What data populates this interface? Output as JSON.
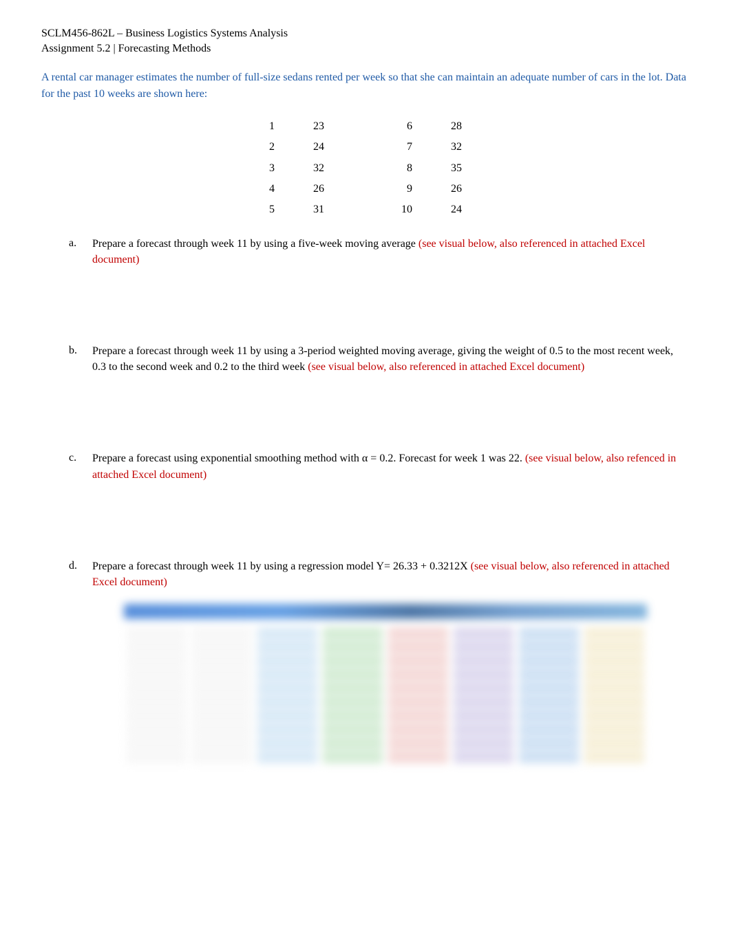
{
  "header": {
    "course": "SCLM456-862L – Business Logistics Systems Analysis",
    "assignment": "Assignment 5.2 | Forecasting Methods"
  },
  "intro": "A rental car manager estimates the number of full-size sedans rented per week so that she can maintain an adequate number of cars in the lot. Data for the past 10 weeks are shown here:",
  "data_rows": [
    {
      "w1": "1",
      "v1": "23",
      "w2": "6",
      "v2": "28"
    },
    {
      "w1": "2",
      "v1": "24",
      "w2": "7",
      "v2": "32"
    },
    {
      "w1": "3",
      "v1": "32",
      "w2": "8",
      "v2": "35"
    },
    {
      "w1": "4",
      "v1": "26",
      "w2": "9",
      "v2": "26"
    },
    {
      "w1": "5",
      "v1": "31",
      "w2": "10",
      "v2": "24"
    }
  ],
  "questions": {
    "a": {
      "letter": "a.",
      "text": "Prepare a forecast through week 11 by using a five-week moving average  ",
      "note": "(see visual below, also referenced in attached Excel document)"
    },
    "b": {
      "letter": "b.",
      "text": "Prepare a forecast through week 11 by using a 3-period weighted moving average, giving the weight of 0.5 to the most recent week, 0.3 to the second week and 0.2 to the third week     ",
      "note": "(see visual below, also referenced in attached Excel document)"
    },
    "c": {
      "letter": "c.",
      "text": "Prepare a forecast using exponential smoothing method with α = 0.2. Forecast for week 1 was 22.   ",
      "note": "(see visual below, also refenced in attached Excel document)"
    },
    "d": {
      "letter": "d.",
      "text": "Prepare a forecast through week 11 by using a regression model Y= 26.33 + 0.3212X  ",
      "note": "(see visual below, also referenced in attached Excel document)"
    }
  }
}
